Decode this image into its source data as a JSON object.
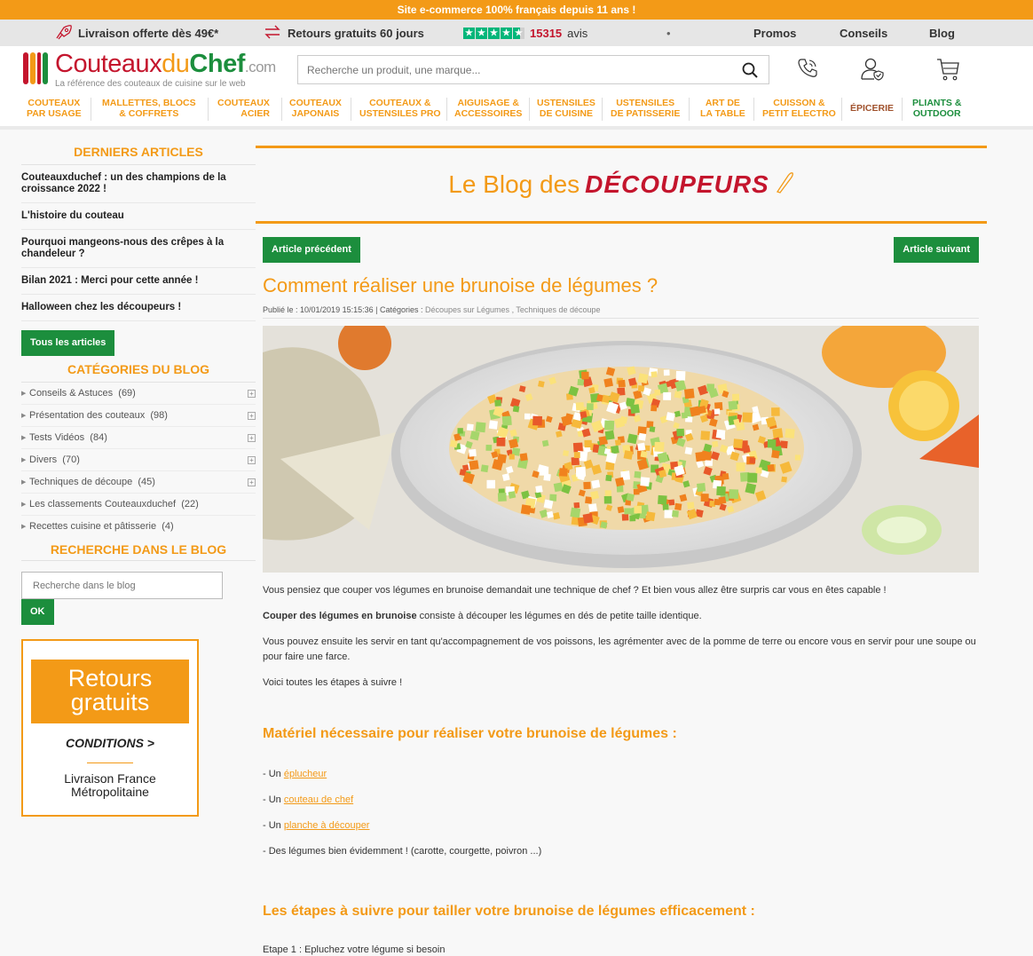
{
  "topbar": {
    "text": "Site e-commerce 100% français depuis 11 ans !"
  },
  "infobar": {
    "delivery": "Livraison offerte dès 49€*",
    "returns": "Retours gratuits 60 jours",
    "review_count": "15315",
    "review_label": "avis",
    "dot": "•",
    "promos": "Promos",
    "conseils": "Conseils",
    "blog": "Blog"
  },
  "logo": {
    "part1": "Couteaux",
    "part2": "du",
    "part3": "Chef",
    "part4": ".com",
    "tagline": "La référence des couteaux de cuisine sur le web"
  },
  "search": {
    "placeholder": "Recherche un produit, une marque..."
  },
  "nav": [
    {
      "l1": "COUTEAUX",
      "l2": "PAR USAGE"
    },
    {
      "l1": "MALLETTES, BLOCS",
      "l2": "& COFFRETS"
    },
    {
      "l1": "COUTEAUX",
      "l2": "ACIER"
    },
    {
      "l1": "COUTEAUX",
      "l2": "JAPONAIS"
    },
    {
      "l1": "COUTEAUX &",
      "l2": "USTENSILES PRO"
    },
    {
      "l1": "AIGUISAGE &",
      "l2": "ACCESSOIRES"
    },
    {
      "l1": "USTENSILES",
      "l2": "DE CUISINE"
    },
    {
      "l1": "USTENSILES",
      "l2": "DE PATISSERIE"
    },
    {
      "l1": "ART DE",
      "l2": "LA TABLE"
    },
    {
      "l1": "CUISSON &",
      "l2": "PETIT ELECTRO"
    },
    {
      "l1": "ÉPICERIE",
      "l2": ""
    },
    {
      "l1": "PLIANTS &",
      "l2": "OUTDOOR"
    }
  ],
  "colors": {
    "orange": "#f39a17",
    "red": "#c4152d",
    "green": "#1c8e3d",
    "brown": "#a0522d"
  },
  "sidebar": {
    "latest_title": "DERNIERS ARTICLES",
    "articles": [
      "Couteauxduchef : un des champions de la croissance 2022 !",
      "L'histoire du couteau",
      "Pourquoi mangeons-nous des crêpes à la chandeleur ?",
      "Bilan 2021 : Merci pour cette année !",
      "Halloween chez les découpeurs !"
    ],
    "all_articles": "Tous les articles",
    "categories_title": "CATÉGORIES DU BLOG",
    "categories": [
      {
        "name": "Conseils & Astuces",
        "count": "(69)"
      },
      {
        "name": "Présentation des couteaux",
        "count": "(98)"
      },
      {
        "name": "Tests Vidéos",
        "count": "(84)"
      },
      {
        "name": "Divers",
        "count": "(70)"
      },
      {
        "name": "Techniques de découpe",
        "count": "(45)"
      },
      {
        "name": "Les classements Couteauxduchef",
        "count": "(22)"
      },
      {
        "name": "Recettes cuisine et pâtisserie",
        "count": "(4)"
      }
    ],
    "search_title": "RECHERCHE DANS LE BLOG",
    "search_placeholder": "Recherche dans le blog",
    "ok": "OK",
    "promo": {
      "line1": "Retours",
      "line2": "gratuits",
      "conditions": "CONDITIONS >",
      "liv1": "Livraison France",
      "liv2": "Métropolitaine"
    }
  },
  "main": {
    "banner_prefix": "Le Blog des",
    "banner_word": "DÉCOUPEURS",
    "prev": "Article précédent",
    "next": "Article suivant",
    "title": "Comment réaliser une brunoise de légumes ?",
    "meta_prefix": "Publié le : 10/01/2019 15:15:36 | Catégories :",
    "meta_cat1": "Découpes sur Légumes",
    "meta_sep": ",",
    "meta_cat2": "Techniques de découpe",
    "p1": "Vous pensiez que couper vos légumes en brunoise demandait une technique de chef ? Et bien vous allez être surpris car vous en êtes capable !",
    "p2_bold": "Couper des légumes en brunoise",
    "p2_rest": " consiste à découper les légumes en dés de petite taille identique.",
    "p3": "Vous pouvez ensuite les servir en tant qu'accompagnement de vos poissons, les agrémenter avec de la pomme de terre ou encore vous en servir pour une soupe ou pour faire une farce.",
    "p4": "Voici toutes les étapes à suivre !",
    "h2_material": "Matériel nécessaire pour réaliser votre brunoise de légumes :",
    "item_prefix": "- Un ",
    "item1_link": "éplucheur",
    "item2_link": "couteau de chef",
    "item3_link": "planche à découper",
    "item4": "- Des légumes bien évidemment ! (carotte, courgette, poivron ...)",
    "h2_steps": "Les étapes à suivre pour tailler votre brunoise de légumes efficacement :",
    "step1": "Etape 1 : Epluchez votre légume si besoin"
  }
}
